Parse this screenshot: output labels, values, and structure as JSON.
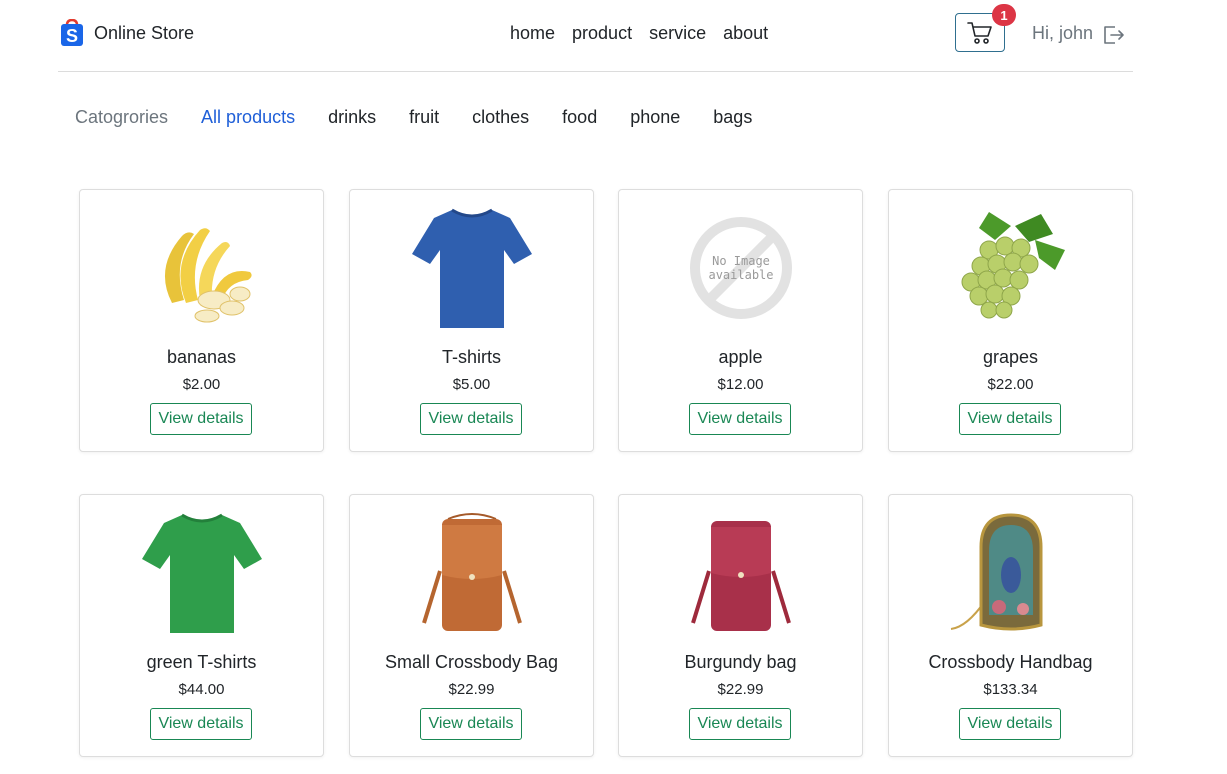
{
  "header": {
    "brand": {
      "logo_letter": "S",
      "name": "Online Store"
    },
    "nav": [
      "home",
      "product",
      "service",
      "about"
    ],
    "cart": {
      "icon": "cart-icon",
      "count": "1"
    },
    "greeting": "Hi, john",
    "logout_icon": "logout-icon"
  },
  "categories": {
    "label": "Catogrories",
    "items": [
      "All products",
      "drinks",
      "fruit",
      "clothes",
      "food",
      "phone",
      "bags"
    ],
    "active": "All products"
  },
  "products": [
    {
      "name": "bananas",
      "price": "$2.00",
      "button": "View details",
      "image": "bananas-image"
    },
    {
      "name": "T-shirts",
      "price": "$5.00",
      "button": "View details",
      "image": "blue-tshirt-image"
    },
    {
      "name": "apple",
      "price": "$12.00",
      "button": "View details",
      "image": "no-image-placeholder",
      "placeholder_text": [
        "No Image",
        "available"
      ]
    },
    {
      "name": "grapes",
      "price": "$22.00",
      "button": "View details",
      "image": "grapes-image"
    },
    {
      "name": "green T-shirts",
      "price": "$44.00",
      "button": "View details",
      "image": "green-tshirt-image"
    },
    {
      "name": "Small Crossbody Bag",
      "price": "$22.99",
      "button": "View details",
      "image": "brown-bag-image"
    },
    {
      "name": "Burgundy bag",
      "price": "$22.99",
      "button": "View details",
      "image": "burgundy-bag-image"
    },
    {
      "name": "Crossbody Handbag",
      "price": "$133.34",
      "button": "View details",
      "image": "embroidered-handbag-image"
    }
  ],
  "colors": {
    "accent": "#1f5fd8",
    "button": "#198754",
    "badge": "#dc3545",
    "logo_blue": "#1a66e8",
    "logo_red": "#e23b2e"
  }
}
